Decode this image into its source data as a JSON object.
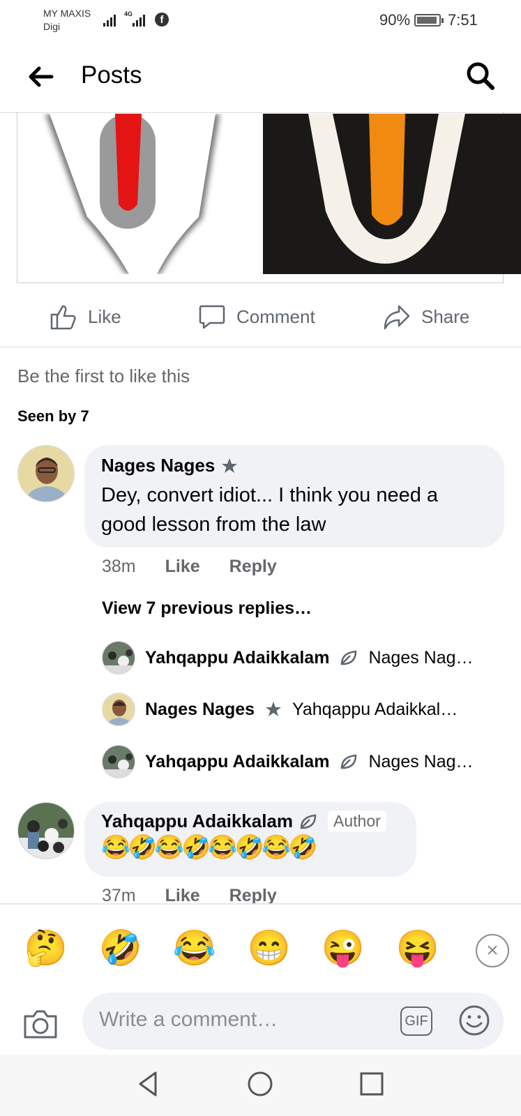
{
  "status_bar": {
    "carrier_1": "MY MAXIS",
    "carrier_2": "Digi",
    "network": "4G",
    "facebook_indicator": "f",
    "battery": "90%",
    "time": "7:51"
  },
  "header": {
    "title": "Posts",
    "back_icon": "back-arrow-icon",
    "search_icon": "search-icon"
  },
  "post_actions": {
    "like_label": "Like",
    "comment_label": "Comment",
    "share_label": "Share"
  },
  "reactions_summary": {
    "first_like_text": "Be the first to like this",
    "seen_by": "Seen by 7"
  },
  "comments": [
    {
      "author": "Nages Nages",
      "badge_icon": "star-badge-icon",
      "text": "Dey, convert idiot... I think you need a good lesson from the law",
      "time": "38m",
      "like_label": "Like",
      "reply_label": "Reply"
    },
    {
      "author": "Yahqappu Adaikkalam",
      "badge_icon": "leaf-badge-icon",
      "author_tag": "Author",
      "text": "😂🤣😂🤣😂🤣😂🤣",
      "time": "37m",
      "like_label": "Like",
      "reply_label": "Reply"
    }
  ],
  "view_previous": "View 7 previous replies…",
  "replies": [
    {
      "author": "Yahqappu Adaikkalam",
      "badge_icon": "leaf-badge-icon",
      "preview": "Nages Nag…"
    },
    {
      "author": "Nages Nages",
      "badge_icon": "star-badge-icon",
      "preview": "Yahqappu Adaikkal…"
    },
    {
      "author": "Yahqappu Adaikkalam",
      "badge_icon": "leaf-badge-icon",
      "preview": "Nages Nag…"
    }
  ],
  "emoji_suggestions": [
    "🤔",
    "🤣",
    "😂",
    "😁",
    "😜",
    "😝"
  ],
  "composer": {
    "placeholder": "Write a comment…",
    "gif_label": "GIF"
  },
  "colors": {
    "bubble": "#f0f2f5",
    "secondary_text": "#65676b",
    "divider": "#dadde1"
  }
}
